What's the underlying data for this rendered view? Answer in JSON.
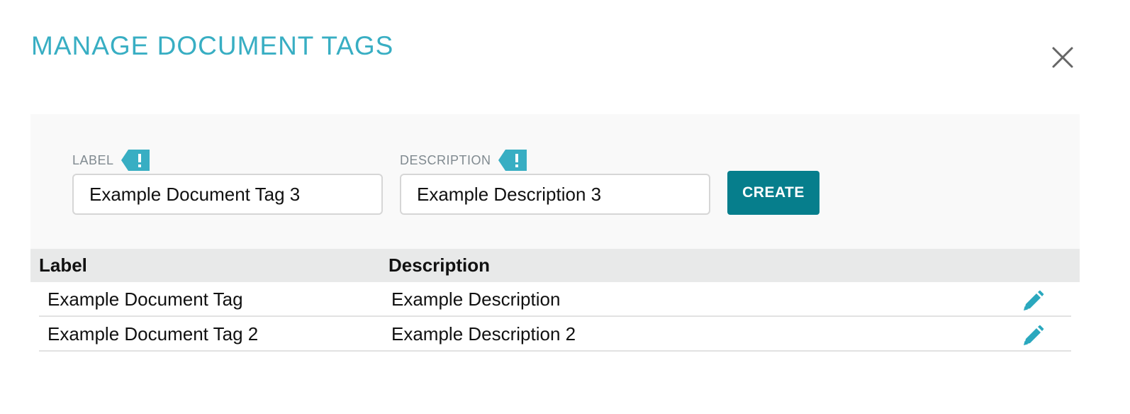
{
  "dialog": {
    "title": "MANAGE DOCUMENT TAGS",
    "close_icon": "close-icon"
  },
  "form": {
    "label_field": {
      "label": "LABEL",
      "value": "Example Document Tag 3",
      "required_icon": "exclamation-tag-icon"
    },
    "description_field": {
      "label": "DESCRIPTION",
      "value": "Example Description 3",
      "required_icon": "exclamation-tag-icon"
    },
    "create_label": "CREATE"
  },
  "table": {
    "columns": [
      "Label",
      "Description"
    ],
    "rows": [
      {
        "label": "Example Document Tag",
        "description": "Example Description",
        "action_icon": "pencil-icon"
      },
      {
        "label": "Example Document Tag 2",
        "description": "Example Description 2",
        "action_icon": "pencil-icon"
      }
    ]
  },
  "colors": {
    "accent": "#38aec3",
    "primary_button": "#067e8c",
    "panel_bg": "#f9f9f9",
    "header_bg": "#e8e9e9"
  }
}
